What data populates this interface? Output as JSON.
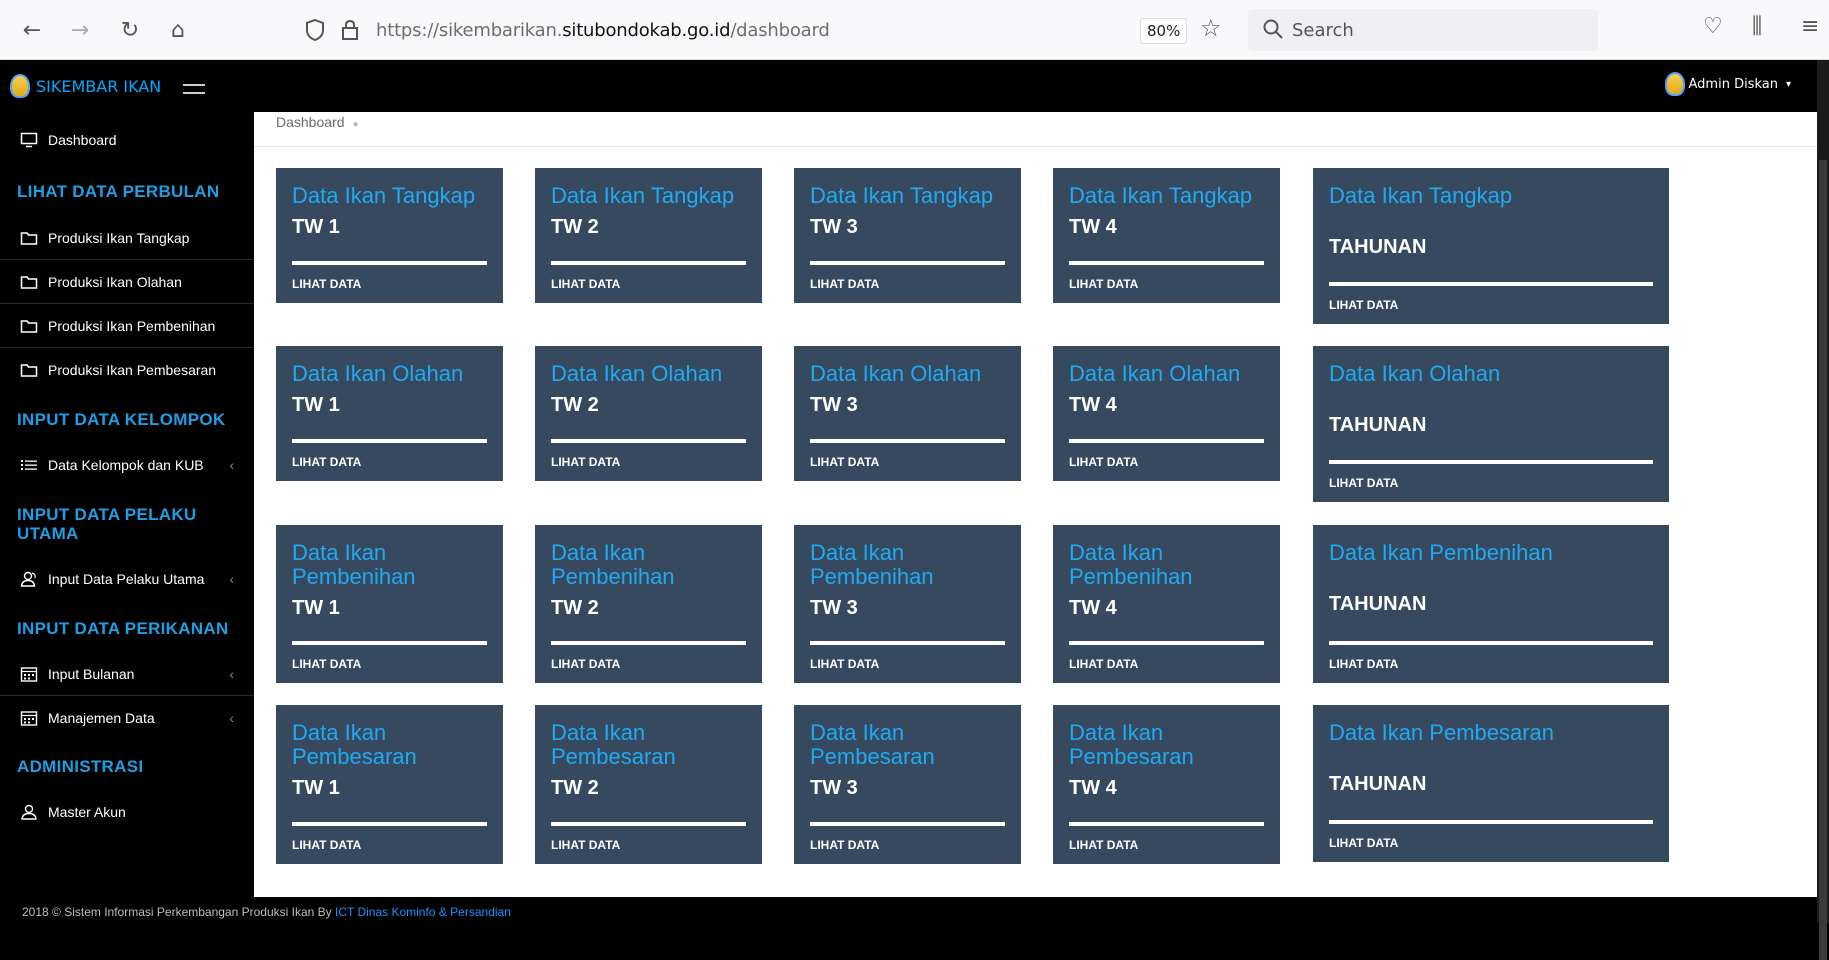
{
  "browser": {
    "url_prefix": "https://sikembarikan.",
    "url_domain": "situbondokab.go.id",
    "url_path": "/dashboard",
    "zoom": "80%",
    "search_placeholder": "Search"
  },
  "header": {
    "brand": "SIKEMBAR IKAN",
    "user": "Admin Diskan"
  },
  "sidebar": {
    "dashboard": "Dashboard",
    "sections": {
      "perbulan": "LIHAT DATA PERBULAN",
      "kelompok": "INPUT DATA KELOMPOK",
      "pelaku": "INPUT DATA PELAKU UTAMA",
      "perikanan": "INPUT DATA PERIKANAN",
      "admin": "ADMINISTRASI"
    },
    "items": {
      "tangkap": "Produksi Ikan Tangkap",
      "olahan": "Produksi Ikan Olahan",
      "pembenihan": "Produksi Ikan Pembenihan",
      "pembesaran": "Produksi Ikan Pembesaran",
      "kub": "Data Kelompok dan KUB",
      "pelaku": "Input Data Pelaku Utama",
      "bulanan": "Input Bulanan",
      "manajemen": "Manajemen Data",
      "akun": "Master Akun"
    }
  },
  "breadcrumb": "Dashboard",
  "cards": [
    [
      {
        "title": "Data Ikan Tangkap",
        "sub": "TW 1",
        "link": "LIHAT DATA"
      },
      {
        "title": "Data Ikan Tangkap",
        "sub": "TW 2",
        "link": "LIHAT DATA"
      },
      {
        "title": "Data Ikan Tangkap",
        "sub": "TW 3",
        "link": "LIHAT DATA"
      },
      {
        "title": "Data Ikan Tangkap",
        "sub": "TW 4",
        "link": "LIHAT DATA"
      },
      {
        "title": "Data Ikan Tangkap",
        "sub": "TAHUNAN",
        "link": "LIHAT DATA"
      }
    ],
    [
      {
        "title": "Data Ikan Olahan",
        "sub": "TW 1",
        "link": "LIHAT DATA"
      },
      {
        "title": "Data Ikan Olahan",
        "sub": "TW 2",
        "link": "LIHAT DATA"
      },
      {
        "title": "Data Ikan Olahan",
        "sub": "TW 3",
        "link": "LIHAT DATA"
      },
      {
        "title": "Data Ikan Olahan",
        "sub": "TW 4",
        "link": "LIHAT DATA"
      },
      {
        "title": "Data Ikan Olahan",
        "sub": "TAHUNAN",
        "link": "LIHAT DATA"
      }
    ],
    [
      {
        "title": "Data Ikan Pembenihan",
        "sub": "TW 1",
        "link": "LIHAT DATA"
      },
      {
        "title": "Data Ikan Pembenihan",
        "sub": "TW 2",
        "link": "LIHAT DATA"
      },
      {
        "title": "Data Ikan Pembenihan",
        "sub": "TW 3",
        "link": "LIHAT DATA"
      },
      {
        "title": "Data Ikan Pembenihan",
        "sub": "TW 4",
        "link": "LIHAT DATA"
      },
      {
        "title": "Data Ikan Pembenihan",
        "sub": "TAHUNAN",
        "link": "LIHAT DATA"
      }
    ],
    [
      {
        "title": "Data Ikan Pembesaran",
        "sub": "TW 1",
        "link": "LIHAT DATA"
      },
      {
        "title": "Data Ikan Pembesaran",
        "sub": "TW 2",
        "link": "LIHAT DATA"
      },
      {
        "title": "Data Ikan Pembesaran",
        "sub": "TW 3",
        "link": "LIHAT DATA"
      },
      {
        "title": "Data Ikan Pembesaran",
        "sub": "TW 4",
        "link": "LIHAT DATA"
      },
      {
        "title": "Data Ikan Pembesaran",
        "sub": "TAHUNAN",
        "link": "LIHAT DATA"
      }
    ]
  ],
  "footer": {
    "text": "2018 © Sistem Informasi Perkembangan Produksi Ikan By",
    "link": "ICT Dinas Kominfo & Persandian"
  },
  "colors": {
    "card_bg": "#36495e",
    "accent": "#20aaf2"
  }
}
